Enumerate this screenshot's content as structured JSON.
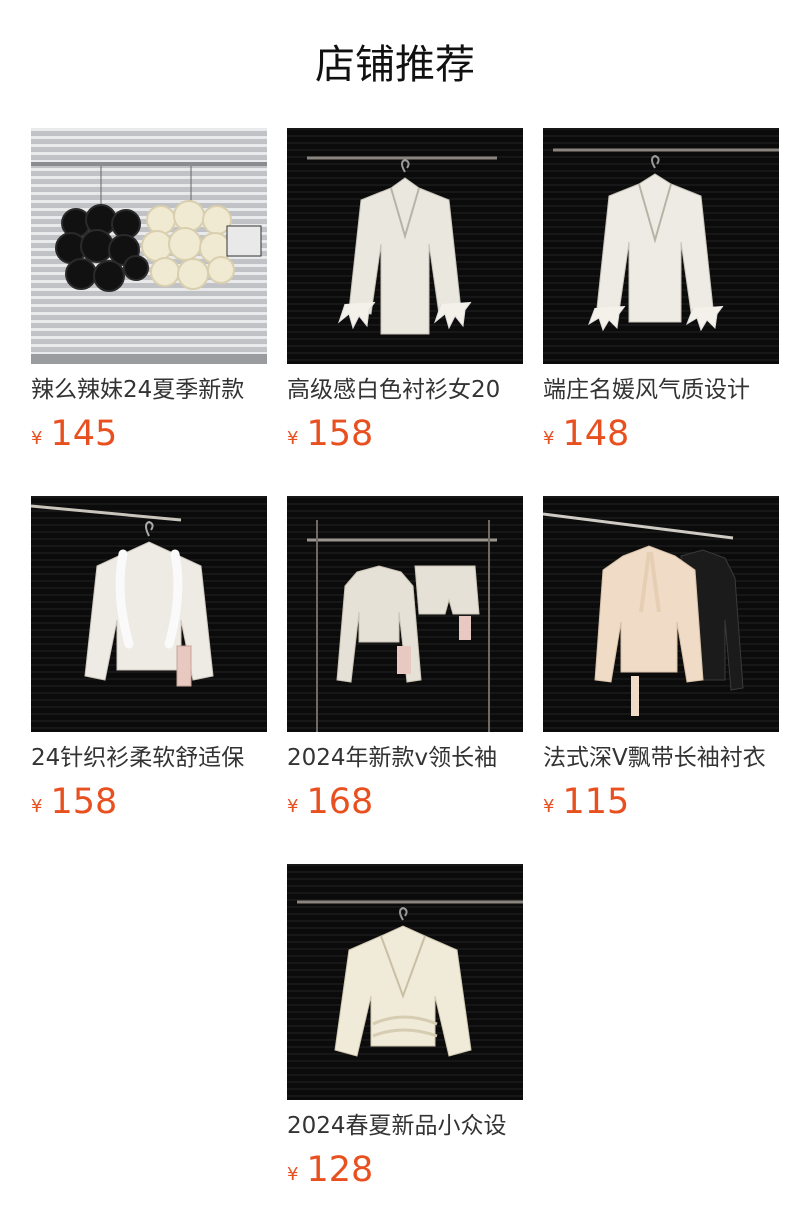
{
  "section": {
    "title": "店铺推荐"
  },
  "products": [
    {
      "name": "辣么辣妹24夏季新款",
      "currency": "¥",
      "price": "145",
      "image": "black-and-cream-rose-skirts"
    },
    {
      "name": "高级感白色衬衫女20",
      "currency": "¥",
      "price": "158",
      "image": "white-satin-feather-cuff-blouse"
    },
    {
      "name": "端庄名媛风气质设计",
      "currency": "¥",
      "price": "148",
      "image": "white-satin-feather-cuff-blouse"
    },
    {
      "name": "24针织衫柔软舒适保",
      "currency": "¥",
      "price": "158",
      "image": "cream-fur-trim-cardigan"
    },
    {
      "name": "2024年新款v领长袖",
      "currency": "¥",
      "price": "168",
      "image": "sequin-crop-top-and-shorts-set"
    },
    {
      "name": "法式深V飘带长袖衬衣",
      "currency": "¥",
      "price": "115",
      "image": "tie-neck-satin-shirts"
    },
    {
      "name": "2024春夏新品小众设",
      "currency": "¥",
      "price": "128",
      "image": "cream-wrap-satin-blouse"
    }
  ],
  "colors": {
    "price": "#e8501f",
    "title": "#111111",
    "name": "#333333",
    "background": "#ffffff"
  }
}
